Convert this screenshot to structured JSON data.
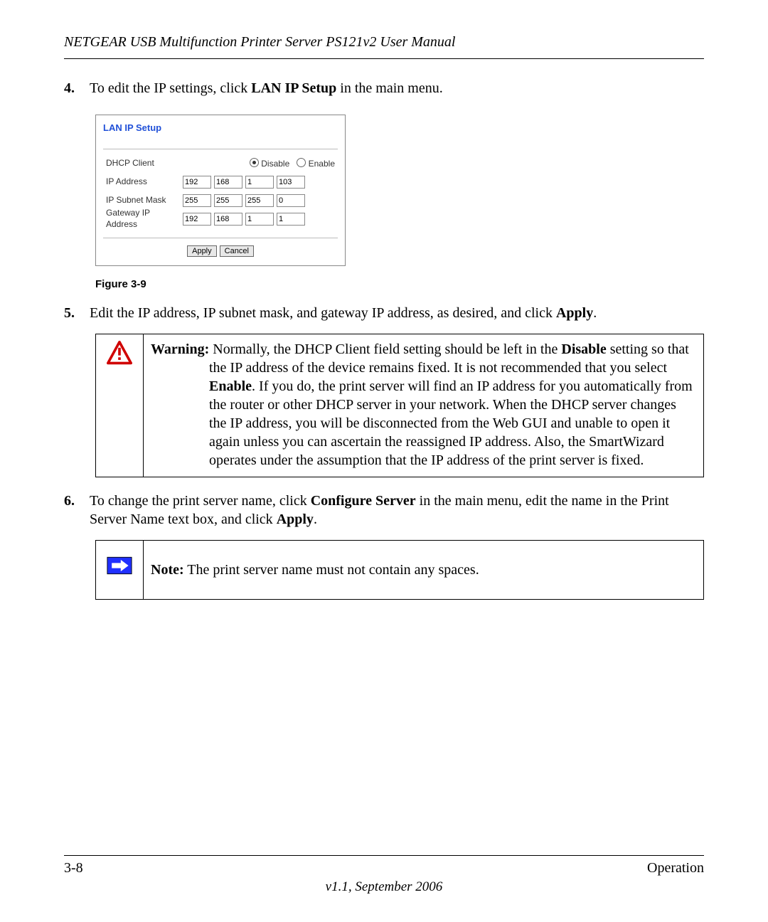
{
  "header": "NETGEAR USB Multifunction Printer Server PS121v2  User Manual",
  "steps": {
    "s4": {
      "num": "4.",
      "pre": "To edit the IP settings, click ",
      "bold": "LAN IP Setup",
      "post": " in the main menu."
    },
    "s5": {
      "num": "5.",
      "pre": "Edit the IP address, IP subnet mask, and gateway IP address, as desired, and click ",
      "bold": "Apply",
      "post": "."
    },
    "s6": {
      "num": "6.",
      "pre": "To change the print server name, click ",
      "bold": "Configure Server",
      "mid": " in the main menu, edit the name in the Print Server Name text box, and click ",
      "bold2": "Apply",
      "post": "."
    }
  },
  "panel": {
    "title": "LAN IP Setup",
    "rows": {
      "dhcp": {
        "label": "DHCP Client",
        "opt1": "Disable",
        "opt2": "Enable",
        "selected": "Disable"
      },
      "ip": {
        "label": "IP Address",
        "o1": "192",
        "o2": "168",
        "o3": "1",
        "o4": "103"
      },
      "mask": {
        "label": "IP Subnet Mask",
        "o1": "255",
        "o2": "255",
        "o3": "255",
        "o4": "0"
      },
      "gw": {
        "label": "Gateway IP Address",
        "o1": "192",
        "o2": "168",
        "o3": "1",
        "o4": "1"
      }
    },
    "apply": "Apply",
    "cancel": "Cancel"
  },
  "figure_caption": "Figure 3-9",
  "warning": {
    "label": "Warning:",
    "seg1": " Normally, the DHCP Client field setting should be left in the ",
    "bold1": "Disable",
    "seg2": " setting so that the IP address of the device remains fixed. It is not recommended that you select ",
    "bold2": "Enable",
    "seg3": ". If you do, the print server will find an IP address for you automatically from the router or other DHCP server in your network. When the DHCP server changes the IP address, you will be disconnected from the Web GUI and unable to open it again unless you can ascertain the reassigned IP address. Also, the SmartWizard operates under the assumption that the IP address of the print server is fixed."
  },
  "note": {
    "label": "Note:",
    "text": " The print server name must not contain any spaces."
  },
  "footer": {
    "left": "3-8",
    "right": "Operation",
    "center": "v1.1, September 2006"
  }
}
